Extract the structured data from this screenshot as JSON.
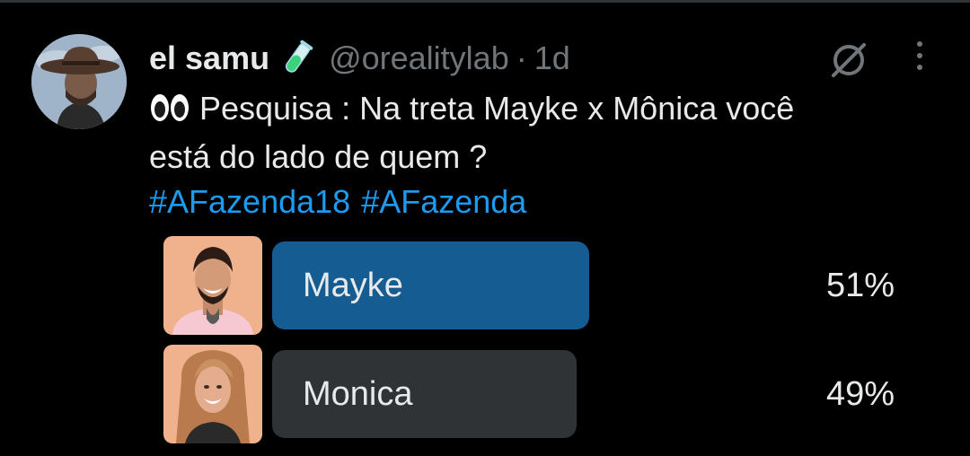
{
  "tweet": {
    "author_name": "el samu",
    "author_emoji": "test-tube-emoji",
    "handle": "@orealitylab",
    "separator": "·",
    "time": "1d",
    "text_emoji": "eyes-emoji",
    "text_line1": "Pesquisa : Na treta Mayke x Mônica você",
    "text_line2": "está do lado de quem ?",
    "hashtags": [
      "#AFazenda18",
      "#AFazenda"
    ]
  },
  "poll": {
    "options": [
      {
        "label": "Mayke",
        "percent": "51%",
        "value": 51,
        "leading": true
      },
      {
        "label": "Monica",
        "percent": "49%",
        "value": 49,
        "leading": false
      }
    ]
  },
  "colors": {
    "background": "#000000",
    "text": "#e7e9ea",
    "secondary_text": "#71767b",
    "link": "#1d9bf0",
    "leading_bar": "#155c92",
    "other_bar": "#2f3336"
  }
}
